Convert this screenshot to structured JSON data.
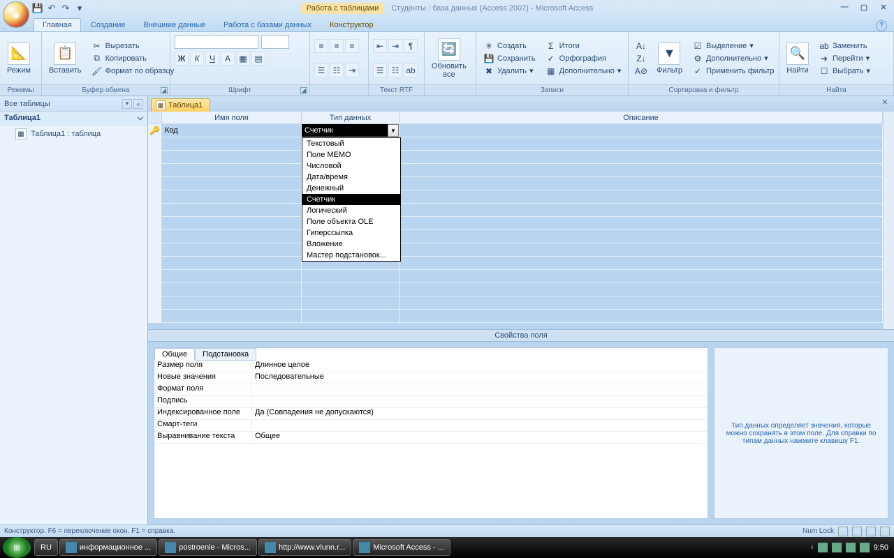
{
  "title": {
    "tool_context": "Работа с таблицами",
    "doc": "Студенты : база данных (Access 2007) - Microsoft Access"
  },
  "ribbon_tabs": {
    "t0": "Главная",
    "t1": "Создание",
    "t2": "Внешние данные",
    "t3": "Работа с базами данных",
    "t4": "Конструктор"
  },
  "ribbon": {
    "modes": {
      "view": "Режим",
      "group": "Режимы"
    },
    "clipboard": {
      "paste": "Вставить",
      "cut": "Вырезать",
      "copy": "Копировать",
      "fmt": "Формат по образцу",
      "group": "Буфер обмена"
    },
    "font": {
      "group": "Шрифт"
    },
    "rtf": {
      "group": "Текст RTF"
    },
    "records": {
      "refresh": "Обновить\nвсе",
      "new": "Создать",
      "save": "Сохранить",
      "delete": "Удалить",
      "totals": "Итоги",
      "spell": "Орфография",
      "more": "Дополнительно",
      "group": "Записи"
    },
    "sort": {
      "filter": "Фильтр",
      "sel": "Выделение",
      "adv": "Дополнительно",
      "apply": "Применить фильтр",
      "group": "Сортировка и фильтр"
    },
    "find": {
      "find": "Найти",
      "replace": "Заменить",
      "goto": "Перейти",
      "select": "Выбрать",
      "group": "Найти"
    }
  },
  "nav": {
    "title": "Все таблицы",
    "group1": "Таблица1",
    "item1": "Таблица1 : таблица"
  },
  "doc_tab": "Таблица1",
  "design_head": {
    "name": "Имя поля",
    "type": "Тип данных",
    "desc": "Описание"
  },
  "field": {
    "name": "Код",
    "type": "Счетчик"
  },
  "type_options": {
    "o0": "Текстовый",
    "o1": "Поле МЕМО",
    "o2": "Числовой",
    "o3": "Дата/время",
    "o4": "Денежный",
    "o5": "Счетчик",
    "o6": "Логический",
    "o7": "Поле объекта OLE",
    "o8": "Гиперссылка",
    "o9": "Вложение",
    "o10": "Мастер подстановок..."
  },
  "splitter": "Свойства поля",
  "prop_tabs": {
    "t0": "Общие",
    "t1": "Подстановка"
  },
  "props": {
    "r0l": "Размер поля",
    "r0v": "Длинное целое",
    "r1l": "Новые значения",
    "r1v": "Последовательные",
    "r2l": "Формат поля",
    "r2v": "",
    "r3l": "Подпись",
    "r3v": "",
    "r4l": "Индексированное поле",
    "r4v": "Да (Совпадения не допускаются)",
    "r5l": "Смарт-теги",
    "r5v": "",
    "r6l": "Выравнивание текста",
    "r6v": "Общее"
  },
  "hint": "Тип данных определяет значения, которые можно сохранять в этом поле.  Для справки по типам данных нажмите клавишу F1.",
  "status": {
    "left": "Конструктор.  F6 = переключение окон.  F1 = справка.",
    "numlock": "Num Lock"
  },
  "taskbar": {
    "lang": "RU",
    "b0": "информационное ...",
    "b1": "postroenie - Micros...",
    "b2": "http://www.vlunn.r...",
    "b3": "Microsoft Access - ...",
    "time": "9:50"
  }
}
